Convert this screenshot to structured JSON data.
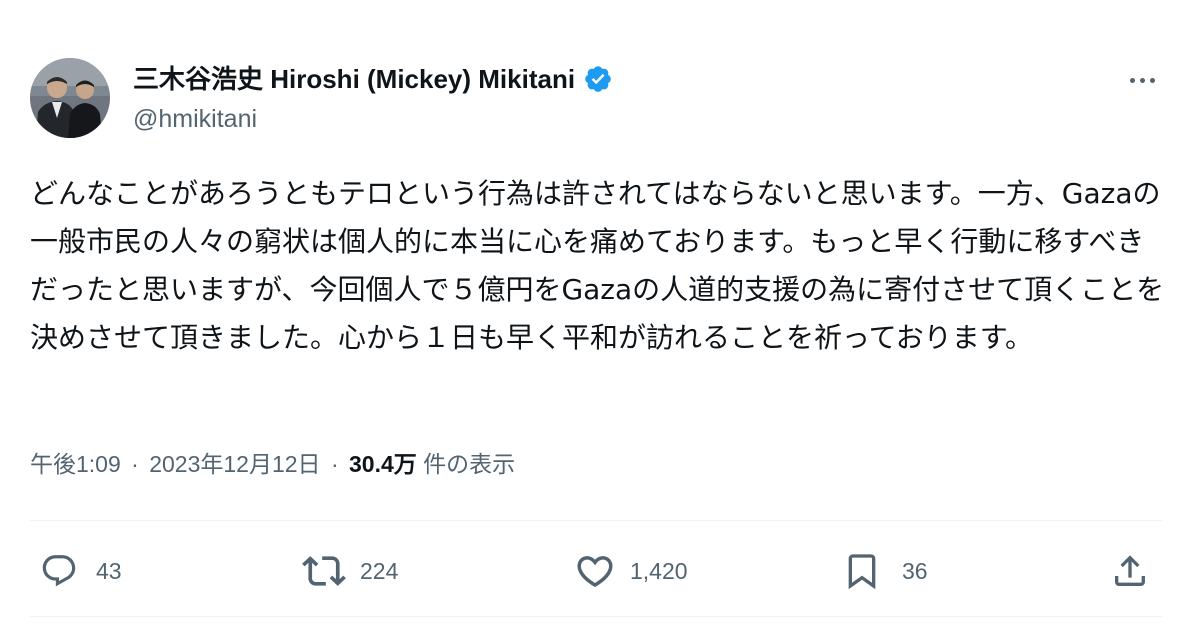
{
  "author": {
    "display_name": "三木谷浩史 Hiroshi (Mickey) Mikitani",
    "handle": "@hmikitani",
    "verified_icon": "verified-badge-icon",
    "verified_color": "#1d9bf0"
  },
  "tweet": {
    "text": "どんなことがあろうともテロという行為は許されてはならないと思います。一方、Gazaの一般市民の人々の窮状は個人的に本当に心を痛めております。もっと早く行動に移すべきだったと思いますが、今回個人で５億円をGazaの人道的支援の為に寄付させて頂くことを決めさせて頂きました。心から１日も早く平和が訪れることを祈っております。"
  },
  "meta": {
    "time": "午後1:09",
    "date": "2023年12月12日",
    "views": "30.4万",
    "views_label": "件の表示",
    "separator": "·"
  },
  "actions": {
    "reply": {
      "icon": "reply-icon",
      "count": "43"
    },
    "retweet": {
      "icon": "retweet-icon",
      "count": "224"
    },
    "like": {
      "icon": "heart-icon",
      "count": "1,420"
    },
    "bookmark": {
      "icon": "bookmark-icon",
      "count": "36"
    },
    "share": {
      "icon": "share-icon"
    }
  },
  "colors": {
    "text": "#0f1419",
    "secondary": "#536471",
    "divider": "#eff3f4"
  }
}
